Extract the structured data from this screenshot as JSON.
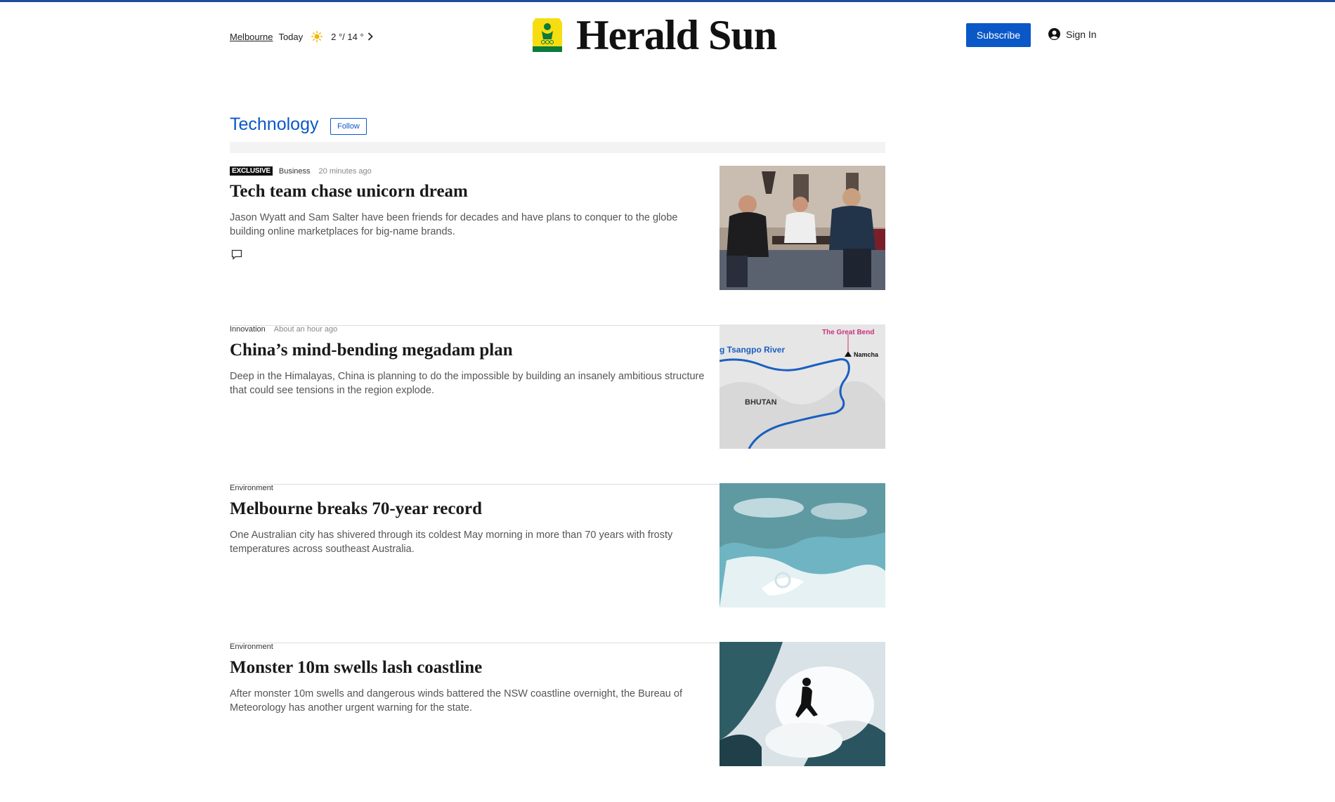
{
  "header": {
    "weather": {
      "location": "Melbourne",
      "day": "Today",
      "temps": "2 °/ 14 °",
      "icon": "sun-icon"
    },
    "brand": "Herald Sun",
    "subscribe_label": "Subscribe",
    "signin_label": "Sign In"
  },
  "section": {
    "title": "Technology",
    "follow_label": "Follow"
  },
  "articles": [
    {
      "badge": "EXCLUSIVE",
      "category": "Business",
      "time": "20 minutes ago",
      "headline": "Tech team chase unicorn dream",
      "standfirst": "Jason Wyatt and Sam Salter have been friends for decades and have plans to conquer to the globe building online marketplaces for big-name brands.",
      "has_comments_icon": true
    },
    {
      "category": "Innovation",
      "time": "About an hour ago",
      "headline": "China’s mind-bending megadam plan",
      "standfirst": "Deep in the Himalayas, China is planning to do the impossible by building an insanely ambitious structure that could see tensions in the region explode.",
      "map_labels": {
        "title": "The Great Bend",
        "river": "g Tsangpo River",
        "town": "Namcha",
        "country": "BHUTAN"
      }
    },
    {
      "category": "Environment",
      "time": "",
      "headline": "Melbourne breaks 70-year record",
      "standfirst": "One Australian city has shivered through its coldest May morning in more than 70 years with frosty temperatures across southeast Australia."
    },
    {
      "category": "Environment",
      "time": "",
      "headline": "Monster 10m swells lash coastline",
      "standfirst": "After monster 10m swells and dangerous winds battered the NSW coastline overnight, the Bureau of Meteorology has another urgent warning for the state."
    }
  ],
  "colors": {
    "accent": "#0a58c7",
    "badge_bg": "#111111",
    "rule": "#1e4d9a"
  }
}
